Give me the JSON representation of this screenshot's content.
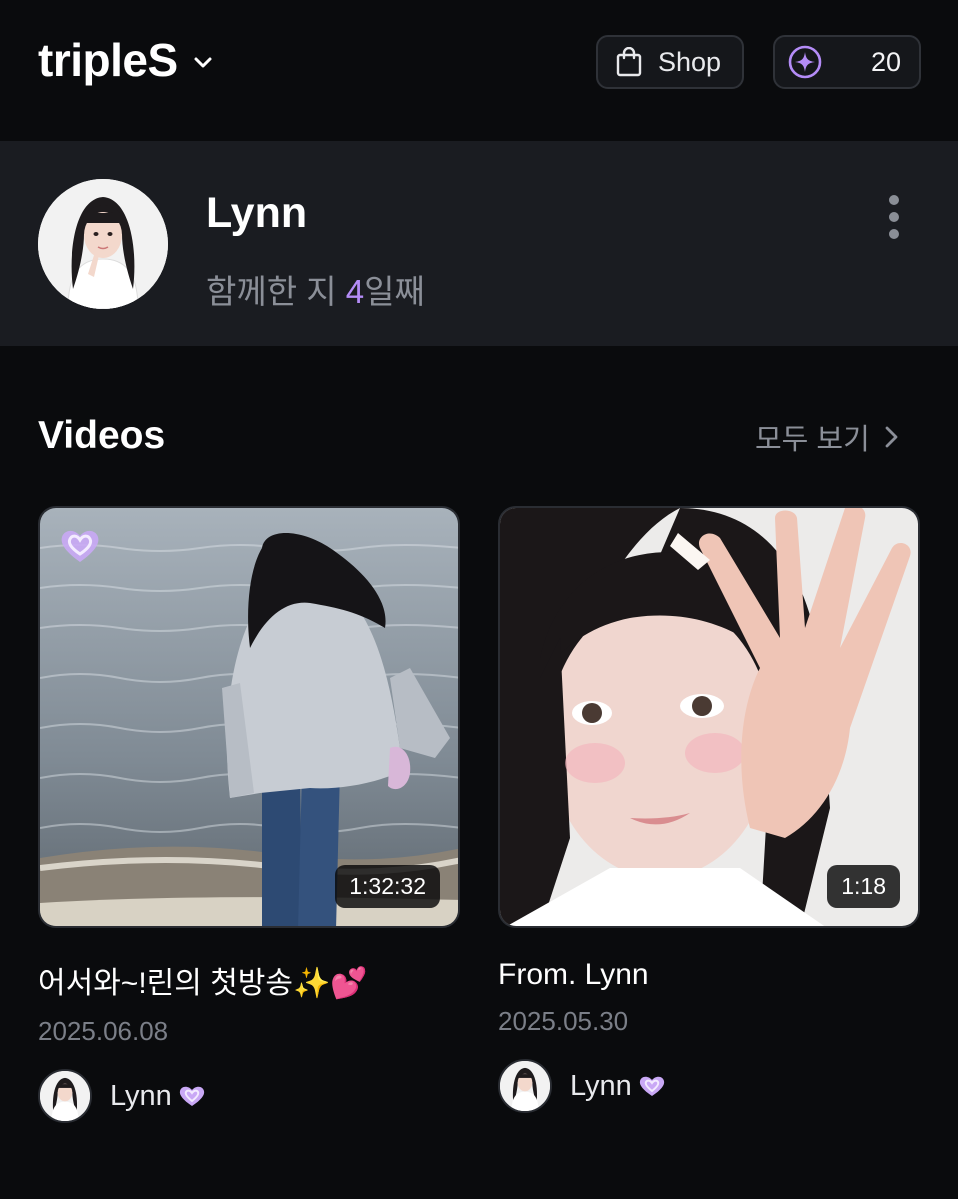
{
  "header": {
    "brand": "tripleS",
    "shop_label": "Shop",
    "points": "20",
    "icons": [
      "chevron-down-icon",
      "shopping-bag-icon",
      "star-coin-icon"
    ]
  },
  "profile": {
    "name": "Lynn",
    "days_prefix": "함께한 지 ",
    "days_count": "4",
    "days_suffix": "일째"
  },
  "videos": {
    "title": "Videos",
    "see_all": "모두 보기",
    "items": [
      {
        "title": "어서와~!린의 첫방송✨💕",
        "date": "2025.06.08",
        "duration": "1:32:32",
        "author": "Lynn"
      },
      {
        "title": "From. Lynn",
        "date": "2025.05.30",
        "duration": "1:18",
        "author": "Lynn"
      }
    ]
  },
  "colors": {
    "background": "#0a0b0d",
    "profile_bg": "#1a1c21",
    "accent": "#b48cf7",
    "muted_text": "#8b8f98"
  }
}
